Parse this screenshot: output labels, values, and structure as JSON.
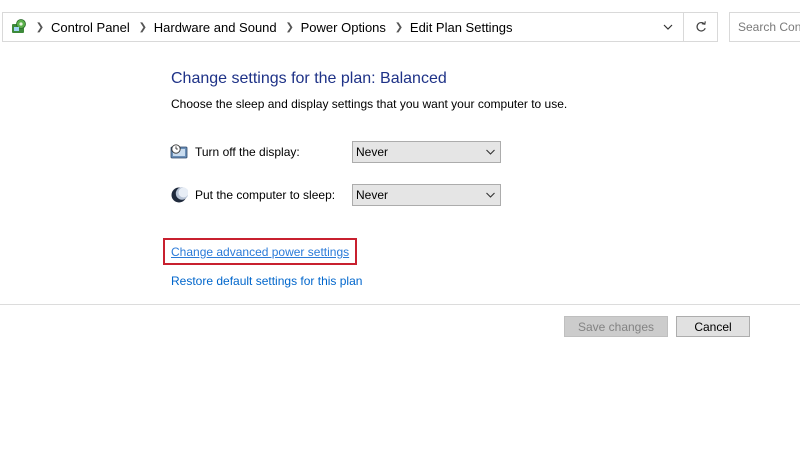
{
  "address_bar": {
    "breadcrumbs": [
      "Control Panel",
      "Hardware and Sound",
      "Power Options",
      "Edit Plan Settings"
    ],
    "search_placeholder": "Search Control Panel"
  },
  "main": {
    "title": "Change settings for the plan: Balanced",
    "description": "Choose the sleep and display settings that you want your computer to use.",
    "settings": [
      {
        "label": "Turn off the display:",
        "value": "Never",
        "icon": "display-timer-icon"
      },
      {
        "label": "Put the computer to sleep:",
        "value": "Never",
        "icon": "sleep-moon-icon"
      }
    ],
    "links": {
      "advanced": "Change advanced power settings",
      "restore": "Restore default settings for this plan"
    }
  },
  "footer": {
    "save_label": "Save changes",
    "save_enabled": false,
    "cancel_label": "Cancel"
  },
  "colors": {
    "heading": "#1e3287",
    "link": "#0066cc",
    "highlight": "#c8202f"
  }
}
